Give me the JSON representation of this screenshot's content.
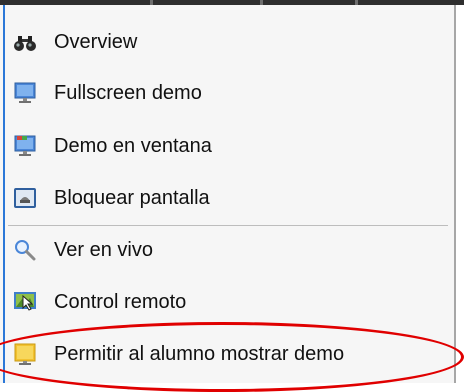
{
  "context_menu": {
    "items": [
      {
        "label": "Overview",
        "icon": "binoculars-icon"
      },
      {
        "label": "Fullscreen demo",
        "icon": "monitor-fullscreen-icon"
      },
      {
        "label": "Demo en ventana",
        "icon": "monitor-window-icon"
      },
      {
        "label": "Bloquear pantalla",
        "icon": "lock-screen-icon"
      },
      {
        "label": "Ver en vivo",
        "icon": "magnifier-icon"
      },
      {
        "label": "Control remoto",
        "icon": "remote-control-icon"
      },
      {
        "label": "Permitir al alumno mostrar demo",
        "icon": "student-demo-icon"
      }
    ]
  },
  "colors": {
    "highlight_circle": "#e00000",
    "menu_background": "#f6f6f6",
    "accent_blue": "#2b78d8"
  }
}
